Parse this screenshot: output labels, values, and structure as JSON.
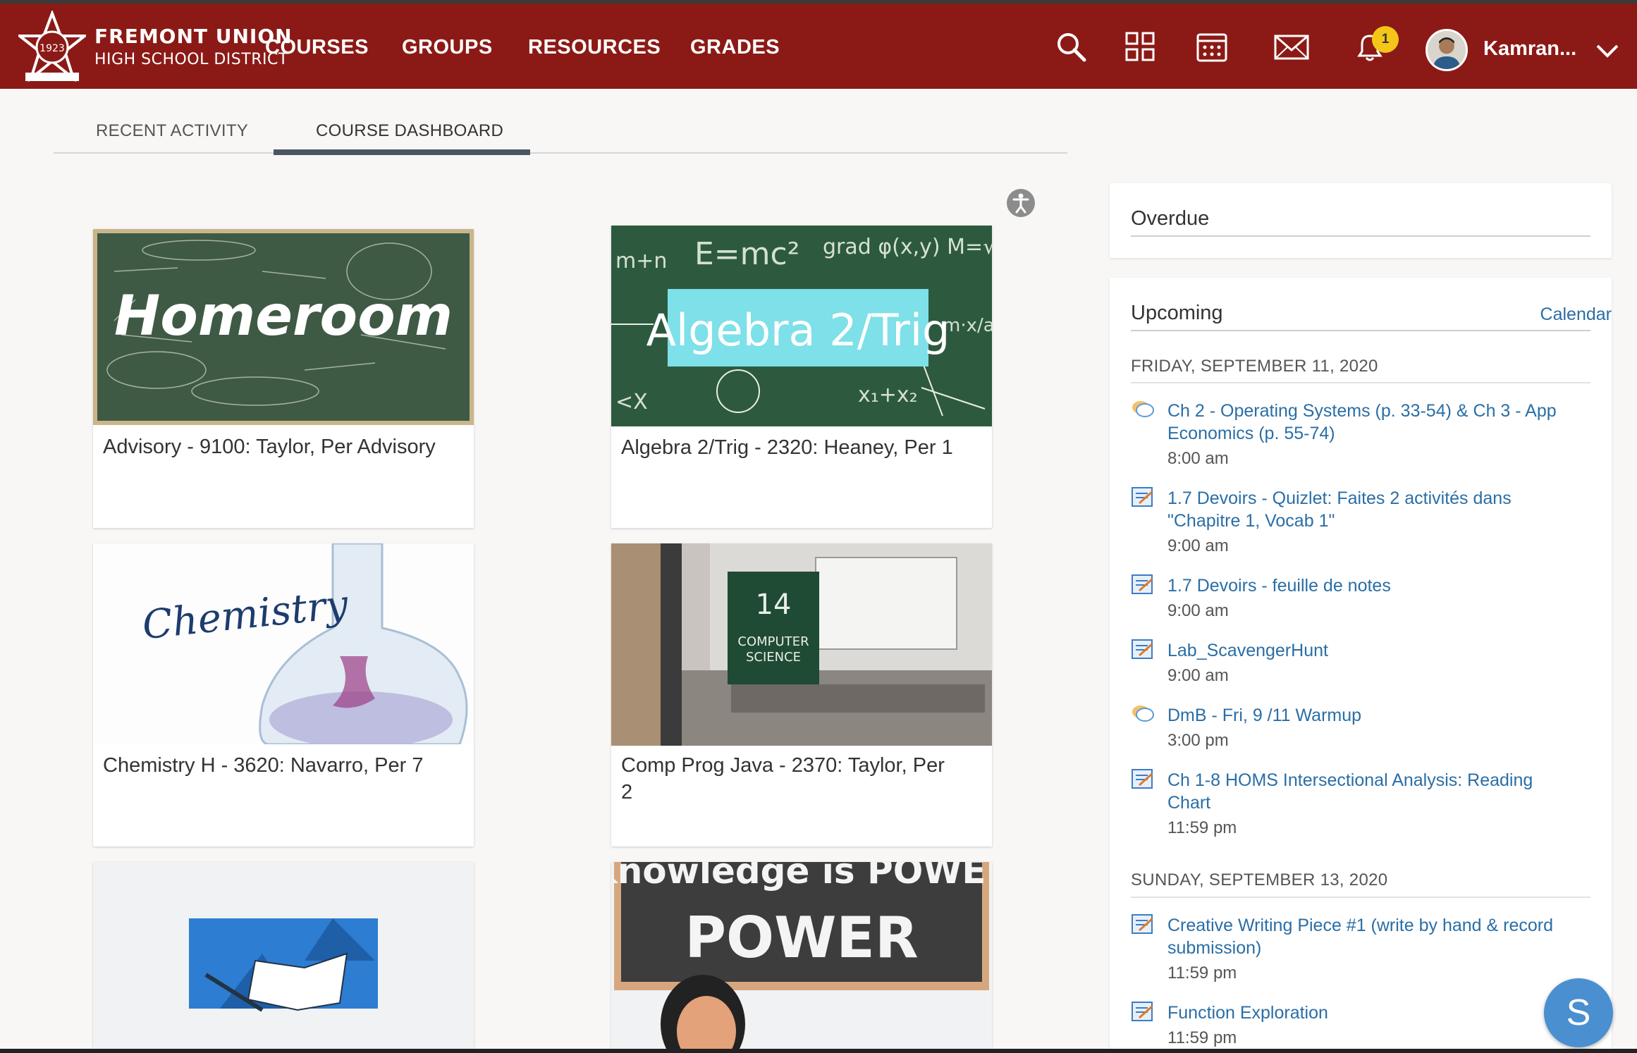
{
  "header": {
    "logo_line1": "FREMONT UNION",
    "logo_line2": "HIGH SCHOOL DISTRICT",
    "nav": [
      "COURSES",
      "GROUPS",
      "RESOURCES",
      "GRADES"
    ],
    "notification_count": "1",
    "username": "Kamran...",
    "icons": [
      "search-icon",
      "apps-grid-icon",
      "calendar-icon",
      "mail-icon",
      "bell-icon",
      "chevron-down-icon"
    ],
    "brand_color": "#8b1a16"
  },
  "tabs": [
    {
      "label": "RECENT ACTIVITY",
      "active": false
    },
    {
      "label": "COURSE DASHBOARD",
      "active": true
    }
  ],
  "courses": [
    {
      "title": "Advisory - 9100: Taylor, Per Advisory",
      "image_text": "Homeroom"
    },
    {
      "title": "Algebra 2/Trig - 2320: Heaney, Per 1",
      "image_text": "Algebra 2/Trig"
    },
    {
      "title": "Chemistry H - 3620: Navarro, Per 7",
      "image_text": "Chemistry"
    },
    {
      "title": "Comp Prog Java - 2370: Taylor, Per 2",
      "image_text": "14 COMPUTER SCIENCE"
    },
    {
      "title": "",
      "image_text": ""
    },
    {
      "title": "",
      "image_text": "Knowledge is POWER"
    }
  ],
  "overdue": {
    "heading": "Overdue"
  },
  "upcoming": {
    "heading": "Upcoming",
    "calendar_link": "Calendar",
    "days": [
      {
        "date": "FRIDAY, SEPTEMBER 11, 2020",
        "events": [
          {
            "icon": "discussion-icon",
            "title": "Ch 2 - Operating Systems (p. 33-54) & Ch 3 - App Economics (p. 55-74)",
            "time": "8:00 am"
          },
          {
            "icon": "assignment-icon",
            "title": "1.7 Devoirs - Quizlet: Faites 2 activités dans \"Chapitre 1, Vocab 1\"",
            "time": "9:00 am"
          },
          {
            "icon": "assignment-icon",
            "title": "1.7 Devoirs - feuille de notes",
            "time": "9:00 am"
          },
          {
            "icon": "assignment-icon",
            "title": "Lab_ScavengerHunt",
            "time": "9:00 am"
          },
          {
            "icon": "discussion-icon",
            "title": "DmB - Fri, 9 /11 Warmup",
            "time": "3:00 pm"
          },
          {
            "icon": "assignment-icon",
            "title": "Ch 1-8 HOMS Intersectional Analysis: Reading Chart",
            "time": "11:59 pm"
          }
        ]
      },
      {
        "date": "SUNDAY, SEPTEMBER 13, 2020",
        "events": [
          {
            "icon": "assignment-icon",
            "title": "Creative Writing Piece #1 (write by hand & record submission)",
            "time": "11:59 pm"
          },
          {
            "icon": "assignment-icon",
            "title": "Function Exploration",
            "time": "11:59 pm"
          }
        ]
      }
    ]
  },
  "chat_button": "S"
}
